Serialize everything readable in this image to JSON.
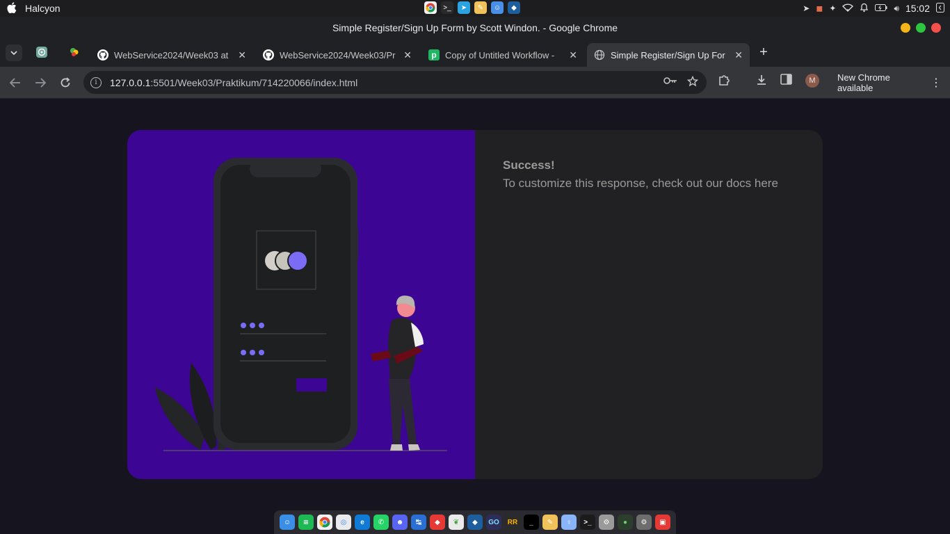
{
  "system_bar": {
    "app_name": "Halcyon",
    "clock": "15:02"
  },
  "window": {
    "title": "Simple Register/Sign Up Form by Scott Windon. - Google Chrome"
  },
  "tabs": [
    {
      "label": "WebService2024/Week03 at",
      "favicon": "github-icon"
    },
    {
      "label": "WebService2024/Week03/Pr",
      "favicon": "github-icon"
    },
    {
      "label": "Copy of Untitled Workflow -",
      "favicon": "pipedream-icon",
      "favicon_text": "p"
    },
    {
      "label": "Simple Register/Sign Up For",
      "favicon": "globe-icon",
      "active": true
    }
  ],
  "toolbar": {
    "url_host": "127.0.0.1",
    "url_path": ":5501/Week03/Praktikum/714220066/index.html",
    "avatar_letter": "M",
    "update_label": "New Chrome available"
  },
  "page": {
    "success_title": "Success!",
    "success_message": "To customize this response, check out our docs here"
  },
  "colors": {
    "card_left": "#3c0593",
    "card_right": "#212123",
    "page_bg": "#16151f",
    "accent": "#7b6cf6"
  }
}
